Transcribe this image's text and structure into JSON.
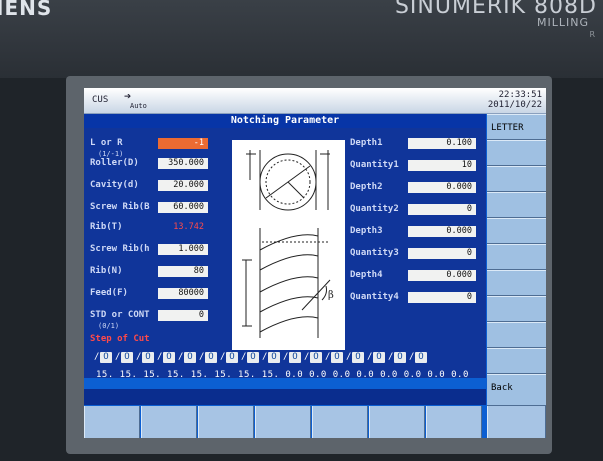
{
  "brand": {
    "left": "IENS",
    "right": "SINUMERIK 808D",
    "sub": "MILLING",
    "sub2": "R"
  },
  "topbar": {
    "mode": "CUS",
    "auto_icon": "➔",
    "auto": "Auto",
    "time": "22:33:51",
    "date": "2011/10/22"
  },
  "dialog": {
    "title": "Notching Parameter"
  },
  "vertical_softkeys": [
    "LETTER",
    "",
    "",
    "",
    "",
    "",
    "",
    "",
    "",
    "",
    "Back"
  ],
  "params_left": [
    {
      "label": "L or R",
      "value": "-1",
      "style": "orange"
    },
    {
      "label": "Roller(D)",
      "value": "350.000"
    },
    {
      "label": "Cavity(d)",
      "value": "20.000"
    },
    {
      "label": "Screw Rib(B",
      "value": "60.000"
    },
    {
      "label": "Rib(T)",
      "value": "13.742",
      "style": "calc"
    },
    {
      "label": "Screw Rib(h",
      "value": "1.000"
    },
    {
      "label": "Rib(N)",
      "value": "80"
    },
    {
      "label": "Feed(F)",
      "value": "80000"
    },
    {
      "label": "STD or CONT",
      "value": "0"
    }
  ],
  "hints": {
    "lr": "(1/-1)",
    "std": "(0/1)"
  },
  "step_label": "Step of Cut",
  "params_right": [
    {
      "label": "Depth1",
      "value": "0.100"
    },
    {
      "label": "Quantity1",
      "value": "10"
    },
    {
      "label": "Depth2",
      "value": "0.000"
    },
    {
      "label": "Quantity2",
      "value": "0"
    },
    {
      "label": "Depth3",
      "value": "0.000"
    },
    {
      "label": "Quantity3",
      "value": "0"
    },
    {
      "label": "Depth4",
      "value": "0.000"
    },
    {
      "label": "Quantity4",
      "value": "0"
    }
  ],
  "tools": {
    "slash": "/",
    "box": "O",
    "count": 16
  },
  "step_values": "15. 15. 15. 15. 15. 15. 15. 15. 0.0 0.0 0.0 0.0 0.0 0.0 0.0 0.0",
  "diagram_symbols": {
    "angle": "β"
  },
  "colors": {
    "screen": "#0c5fd2",
    "panel": "#10359a",
    "title_bar": "#0735a7",
    "selected_field": "#ec6b32",
    "calc_text": "#ff4a4a"
  }
}
